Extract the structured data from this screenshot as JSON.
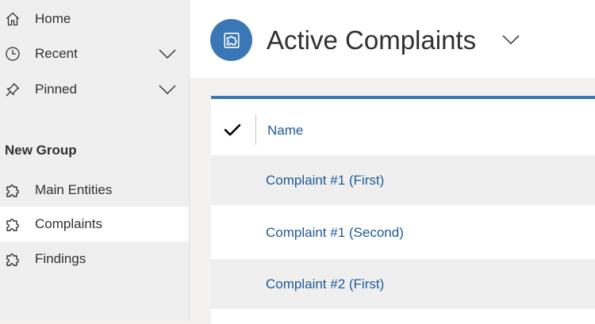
{
  "sidebar": {
    "items": [
      {
        "label": "Home",
        "icon": "home-icon"
      },
      {
        "label": "Recent",
        "icon": "clock-icon"
      },
      {
        "label": "Pinned",
        "icon": "pin-icon"
      }
    ],
    "group": {
      "title": "New Group",
      "items": [
        {
          "label": "Main Entities",
          "icon": "puzzle-icon"
        },
        {
          "label": "Complaints",
          "icon": "puzzle-icon",
          "selected": true
        },
        {
          "label": "Findings",
          "icon": "puzzle-icon"
        }
      ]
    }
  },
  "header": {
    "title": "Active Complaints"
  },
  "grid": {
    "columns": [
      {
        "label": "Name"
      }
    ],
    "rows": [
      {
        "name": "Complaint #1 (First)"
      },
      {
        "name": "Complaint #1 (Second)"
      },
      {
        "name": "Complaint #2 (First)"
      }
    ]
  },
  "colors": {
    "accent": "#3a77b7",
    "link": "#1e5a96",
    "sidebar_bg": "#efefef",
    "text": "#323130"
  }
}
